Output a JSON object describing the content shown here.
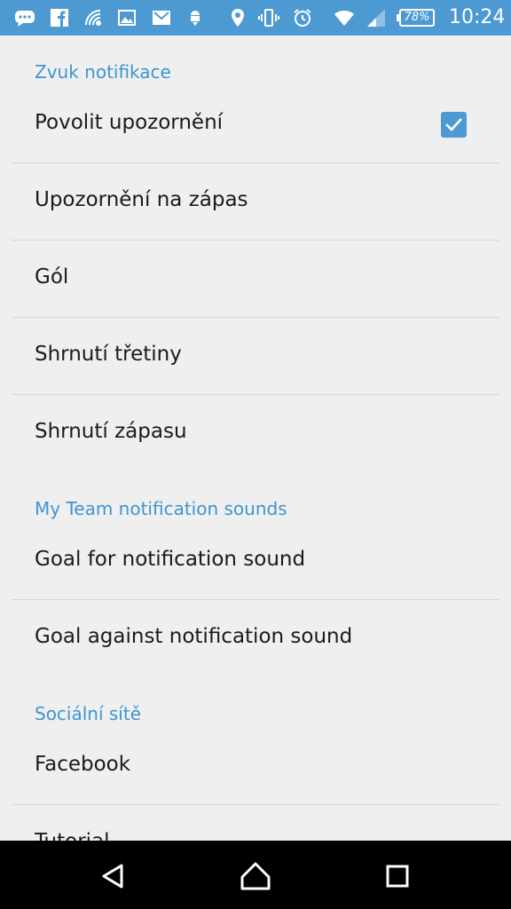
{
  "status_bar": {
    "icons": [
      "chat-bubble-icon",
      "facebook-icon",
      "wifi-calling-icon",
      "image-icon",
      "gmail-icon",
      "android-download-icon",
      "location-icon",
      "vibrate-icon",
      "alarm-icon",
      "wifi-icon",
      "cell-signal-icon"
    ],
    "battery": "78%",
    "time": "10:24"
  },
  "sections": {
    "notification_sound": {
      "header": "Zvuk notifikace",
      "items": {
        "enable": "Povolit upozornění",
        "match_alert": "Upozornění na zápas",
        "goal": "Gól",
        "period_summary": "Shrnutí třetiny",
        "match_summary": "Shrnutí zápasu"
      },
      "enable_checked": true
    },
    "my_team": {
      "header": "My Team notification sounds",
      "items": {
        "goal_for": "Goal for notification sound",
        "goal_against": "Goal against notification sound"
      }
    },
    "social": {
      "header": "Sociální sítě",
      "items": {
        "facebook": "Facebook",
        "tutorial": "Tutorial"
      }
    }
  },
  "colors": {
    "accent": "#4d9ad3",
    "header_text": "#3e95d1",
    "background": "#efefef",
    "nav_bar": "#000000"
  },
  "nav_bar": {
    "buttons": [
      "back-icon",
      "home-icon",
      "recents-icon"
    ]
  }
}
